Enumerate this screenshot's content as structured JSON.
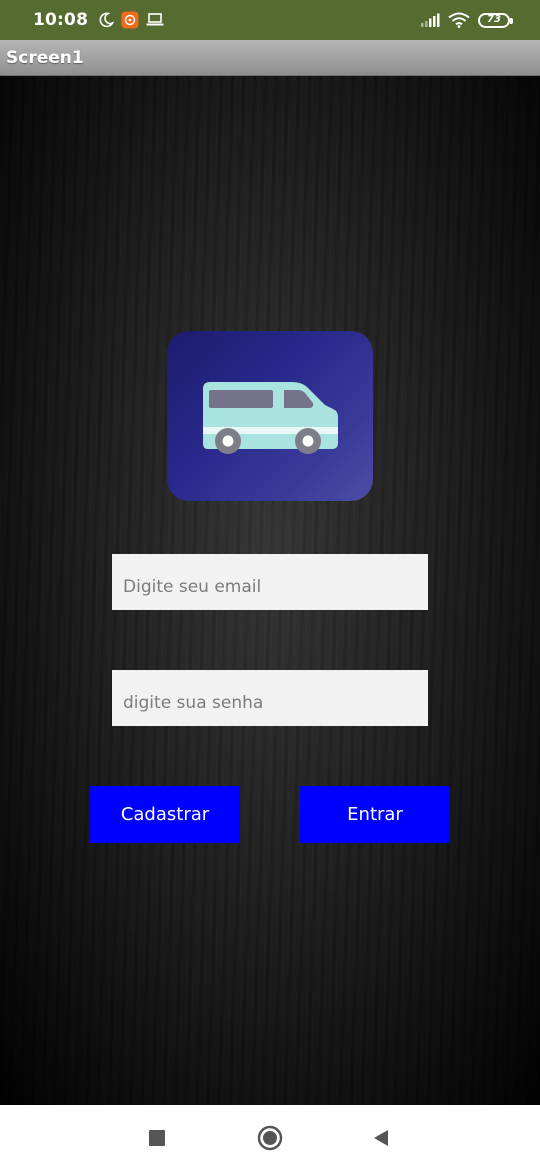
{
  "status_bar": {
    "time": "10:08",
    "battery_level": "73",
    "icons": [
      "moon-icon",
      "app-notification-icon",
      "laptop-icon",
      "signal-icon",
      "wifi-icon",
      "battery-icon"
    ]
  },
  "app": {
    "title": "Screen1"
  },
  "login_form": {
    "email_placeholder": "Digite seu email",
    "password_placeholder": "digite sua senha",
    "register_label": "Cadastrar",
    "login_label": "Entrar"
  },
  "logo": {
    "icon": "van-icon"
  },
  "nav_bar": {
    "icons": [
      "recent-apps-icon",
      "home-icon",
      "back-icon"
    ]
  },
  "colors": {
    "status_bar": "#556b2f",
    "title_bar": "#a0a0a0",
    "button": "#0000ff",
    "field_background": "#f2f2f2",
    "logo_background": "#27288a"
  }
}
